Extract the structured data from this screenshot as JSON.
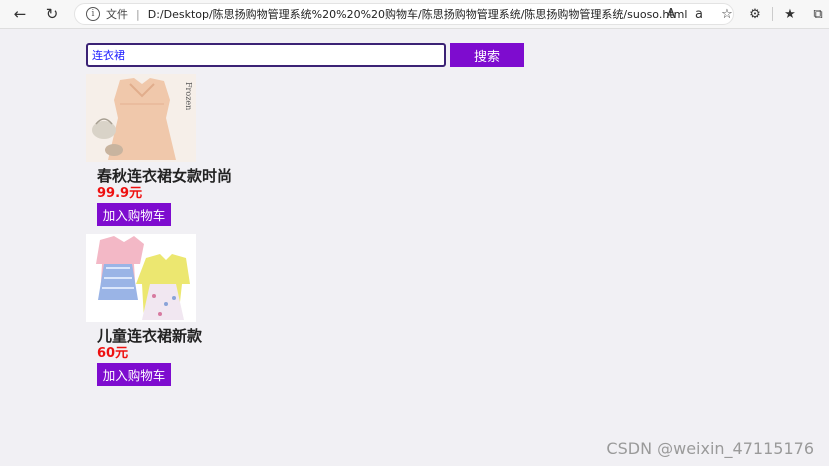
{
  "browser": {
    "file_label": "文件",
    "url": "D:/Desktop/陈思扬购物管理系统%20%20%20购物车/陈思扬购物管理系统/陈思扬购物管理系统/suoso.html"
  },
  "search": {
    "value": "连衣裙",
    "button_label": "搜索"
  },
  "products": [
    {
      "name": "春秋连衣裙女款时尚",
      "price": "99.9元",
      "cart_label": "加入购物车",
      "image": "dress-photo"
    },
    {
      "name": "儿童连衣裙新款",
      "price": "60元",
      "cart_label": "加入购物车",
      "image": "kids-dress-photo"
    }
  ],
  "watermark": "CSDN @weixin_47115176",
  "colors": {
    "accent": "#7e0ccf",
    "price": "#ee1010",
    "input_border": "#3b2275"
  }
}
